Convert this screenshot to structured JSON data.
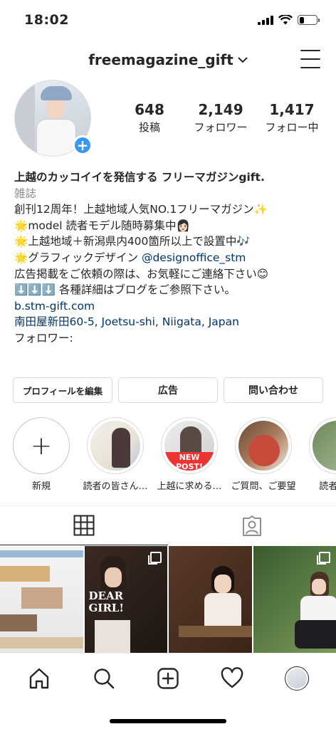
{
  "status": {
    "time": "18:02"
  },
  "header": {
    "username": "freemagazine_gift"
  },
  "profile": {
    "stats": [
      {
        "value": "648",
        "label": "投稿"
      },
      {
        "value": "2,149",
        "label": "フォロワー"
      },
      {
        "value": "1,417",
        "label": "フォロー中"
      }
    ]
  },
  "bio": {
    "name": "上越のカッコイイを発信する フリーマガジンgift.",
    "category": "雑誌",
    "line1": "創刊12周年！上越地域人気NO.1フリーマガジン✨",
    "line2_prefix": "🌟",
    "line2": "model  読者モデル随時募集中👩🏻",
    "line3_prefix": "🌟",
    "line3": "上越地域＋新潟県内400箇所以上で設置中🎶",
    "line4_prefix": "🌟",
    "line4_text": "グラフィックデザイン ",
    "line4_mention": "@designoffice_stm",
    "line5": "広告掲載をご依頼の際は、お気軽にご連絡下さい😊",
    "line6": "⬇️⬇️⬇️ 各種詳細はブログをご参照下さい。",
    "link": "b.stm-gift.com",
    "address": "南田屋新田60-5, Joetsu-shi, Niigata, Japan",
    "followers_label": "フォロワー:"
  },
  "buttons": {
    "edit_profile": "プロフィールを編集",
    "promote": "広告",
    "contact": "問い合わせ"
  },
  "highlights": [
    {
      "label": "新規"
    },
    {
      "label": "読者の皆さん…"
    },
    {
      "label": "上越に求める…"
    },
    {
      "label": "ご質問、ご要望"
    },
    {
      "label": "読者アン"
    }
  ],
  "highlight_images": {
    "new_post_badge": "NEW POST!"
  },
  "grid_images": {
    "poster_text": "DEAR GIRL!"
  },
  "icons": {
    "menu": "hamburger-icon",
    "grid": "grid-icon",
    "tagged": "tagged-person-icon",
    "home": "home-icon",
    "search": "search-icon",
    "add": "add-post-icon",
    "activity": "heart-icon"
  },
  "colors": {
    "accent": "#3897f0",
    "link": "#003569",
    "text": "#262626",
    "muted": "#8e8e8e"
  }
}
